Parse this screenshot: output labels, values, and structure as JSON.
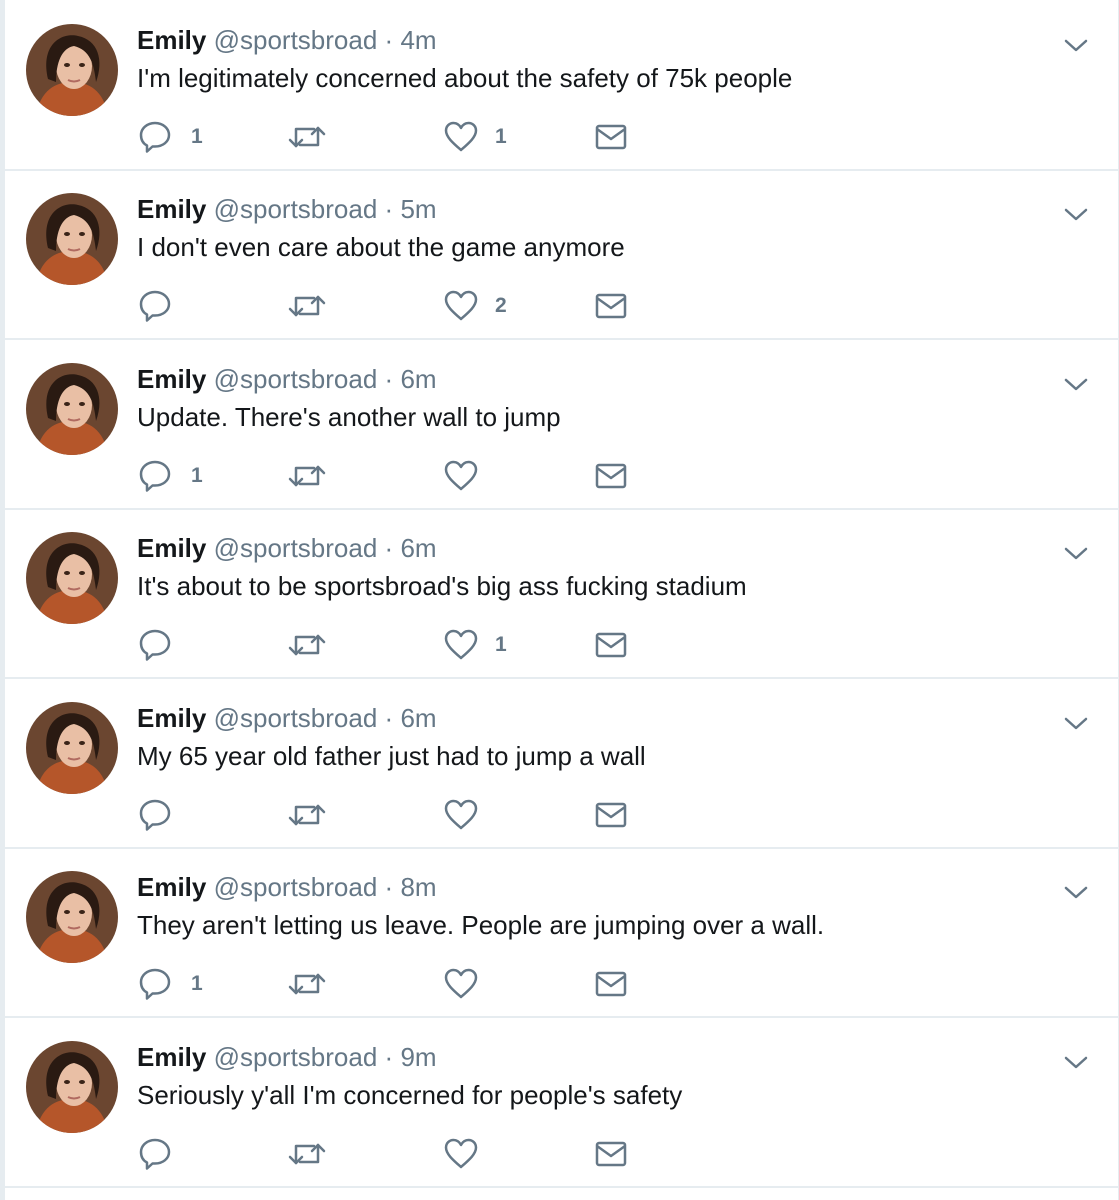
{
  "colors": {
    "name": "#14171a",
    "meta": "#657786",
    "icon": "#657786",
    "divider": "#e6ecf0",
    "background": "#ffffff"
  },
  "icons": {
    "reply": "reply-icon",
    "retweet": "retweet-icon",
    "like": "heart-icon",
    "dm": "envelope-icon",
    "caret": "chevron-down-icon"
  },
  "tweets": [
    {
      "name": "Emily",
      "handle": "@sportsbroad",
      "separator": "·",
      "time": "4m",
      "text": "I'm legitimately concerned about the safety of 75k people",
      "replies": "1",
      "retweets": "",
      "likes": "1"
    },
    {
      "name": "Emily",
      "handle": "@sportsbroad",
      "separator": "·",
      "time": "5m",
      "text": "I don't even care about the game anymore",
      "replies": "",
      "retweets": "",
      "likes": "2"
    },
    {
      "name": "Emily",
      "handle": "@sportsbroad",
      "separator": "·",
      "time": "6m",
      "text": "Update. There's another wall to jump",
      "replies": "1",
      "retweets": "",
      "likes": ""
    },
    {
      "name": "Emily",
      "handle": "@sportsbroad",
      "separator": "·",
      "time": "6m",
      "text": "It's about to be sportsbroad's big ass fucking stadium",
      "replies": "",
      "retweets": "",
      "likes": "1"
    },
    {
      "name": "Emily",
      "handle": "@sportsbroad",
      "separator": "·",
      "time": "6m",
      "text": "My 65 year old father just had to jump a wall",
      "replies": "",
      "retweets": "",
      "likes": ""
    },
    {
      "name": "Emily",
      "handle": "@sportsbroad",
      "separator": "·",
      "time": "8m",
      "text": "They aren't letting us leave. People are jumping over a wall.",
      "replies": "1",
      "retweets": "",
      "likes": ""
    },
    {
      "name": "Emily",
      "handle": "@sportsbroad",
      "separator": "·",
      "time": "9m",
      "text": "Seriously y'all I'm concerned for people's safety",
      "replies": "",
      "retweets": "",
      "likes": ""
    }
  ]
}
